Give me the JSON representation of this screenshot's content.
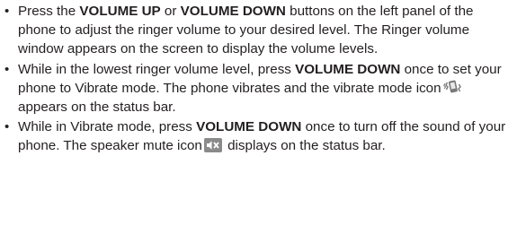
{
  "items": [
    {
      "t1": "Press the ",
      "b1": "VOLUME UP",
      "t2": " or ",
      "b2": "VOLUME DOWN",
      "t3": " buttons on the left panel of the phone to adjust the ringer volume to your desired level. The Ringer volume window appears on the screen to display the volume levels."
    },
    {
      "t1": "While in the lowest ringer volume level, press ",
      "b1": "VOLUME DOWN",
      "t2": " once to set your phone to Vibrate mode. The phone vibrates and the vibrate mode icon",
      "icon": "vibrate-mode-icon",
      "t3": " appears on the status bar."
    },
    {
      "t1": "While in Vibrate mode, press ",
      "b1": "VOLUME DOWN",
      "t2": " once to turn off the sound of your phone. The speaker mute icon",
      "icon": "speaker-mute-icon",
      "t3": " displays on the status bar."
    }
  ],
  "bullet_char": "•",
  "colors": {
    "text": "#231f20",
    "mute_icon_bg": "#8a8a8a",
    "mute_icon_fg": "#ffffff"
  }
}
